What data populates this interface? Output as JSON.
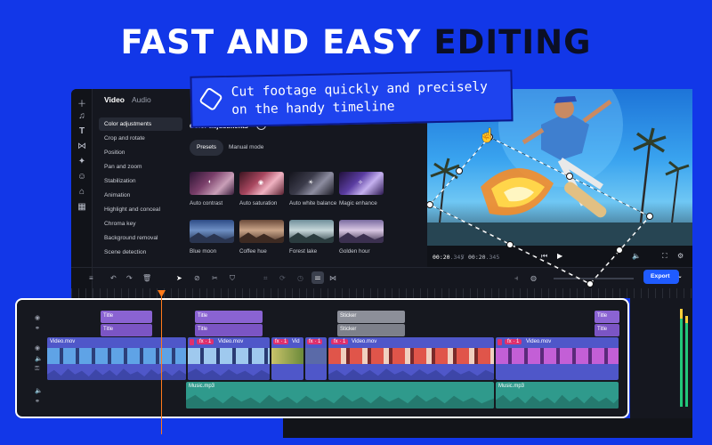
{
  "headline": {
    "part1": "FAST AND EASY",
    "part2": "EDITING"
  },
  "callout": {
    "line1": "Cut footage quickly and precisely",
    "line2": "on the handy timeline"
  },
  "panel": {
    "tabs": [
      "Video",
      "Audio"
    ],
    "items": [
      "Color adjustments",
      "Crop and rotate",
      "Position",
      "Pan and zoom",
      "Stabilization",
      "Animation",
      "Highlight and conceal",
      "Chroma key",
      "Background removal",
      "Scene detection"
    ]
  },
  "content": {
    "title": "Color adjustments",
    "segments": [
      "Presets",
      "Manual mode"
    ],
    "presets": [
      "Auto contrast",
      "Auto saturation",
      "Auto white balance",
      "Magic enhance",
      "Blue moon",
      "Coffee hue",
      "Forest lake",
      "Golden hour"
    ]
  },
  "player": {
    "current": "00:20",
    "current_ms": ".345",
    "total": "00:20",
    "total_ms": ".345"
  },
  "toolbar": {
    "export_label": "Export"
  },
  "timeline": {
    "title_clips": [
      "Title",
      "Title",
      "Title",
      "Title",
      "Title",
      "Title"
    ],
    "sticker_clips": [
      "Sticker",
      "Sticker"
    ],
    "video_clips": [
      "Video.mov",
      "Video.mov",
      "Vid",
      "Video.mov",
      "Video.mov"
    ],
    "fx_badges": [
      "fx · 1",
      "fx · 1",
      "fx · 1",
      "fx · 1"
    ],
    "audio_clips": [
      "Music.mp3",
      "Music.mp3"
    ]
  },
  "colors": {
    "accent": "#1f5bff",
    "title_clip": "#8a63d2",
    "video_clip": "#4f57c9",
    "audio_clip": "#2f9a8c",
    "playhead": "#ff7a1a",
    "fx_badge": "#e0306d"
  }
}
